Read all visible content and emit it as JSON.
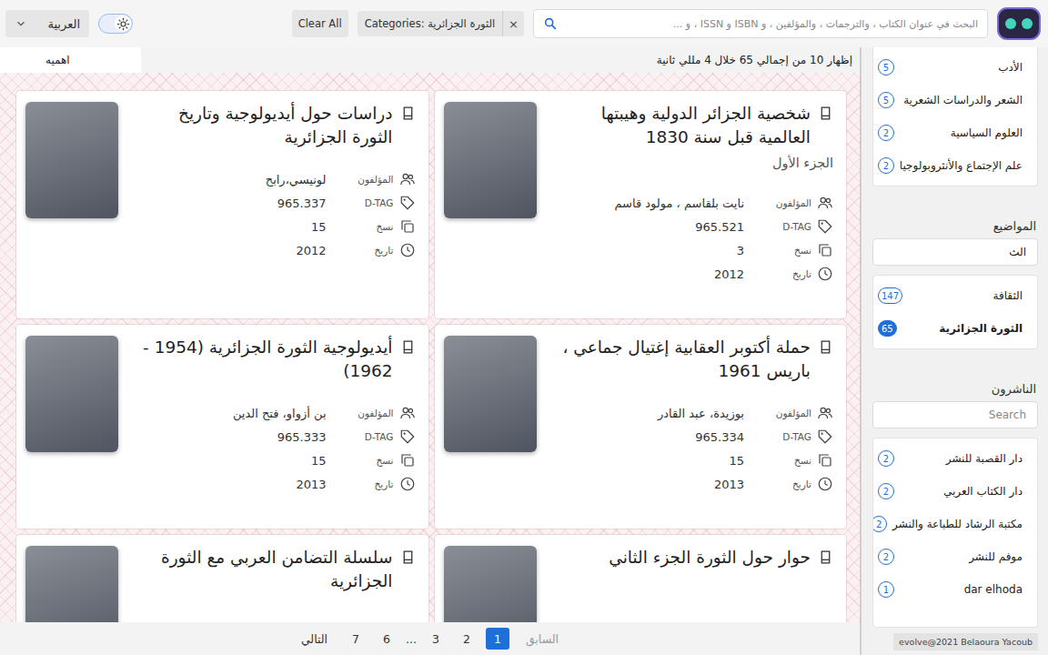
{
  "header": {
    "search": {
      "placeholder": "البحث في عنوان الكتاب ، والترجمات ، والمؤلفين ، و ISBN و ISSN ، و ..."
    },
    "filter_chip": {
      "label": "Categories: الثورة الجزائرية",
      "remove": "×"
    },
    "clear_all": "Clear All",
    "theme_toggle": {
      "dark": false
    },
    "language": "العربية"
  },
  "results": {
    "summary": "إظهار 10 من إجمالي 65 خلال 4 مللي ثانية",
    "sort": "اهميه"
  },
  "field_labels": {
    "authors": "المؤلفون",
    "tag": "D-TAG",
    "copies": "نسخ",
    "date": "تاريخ"
  },
  "books": [
    {
      "title": "شخصية الجزائر الدولية وهيبتها العالمية قبل سنة 1830",
      "subtitle": "الجزء الأول",
      "authors": "نايت بلقاسم ، مولود قاسم",
      "tag": "965.521",
      "copies": "3",
      "date": "2012"
    },
    {
      "title": "دراسات حول أيديولوجية وتاريخ الثورة الجزائرية",
      "authors": "لونيسي،رابح",
      "tag": "965.337",
      "copies": "15",
      "date": "2012"
    },
    {
      "title": "حملة أكتوبر العقابية إغتيال جماعي ، باريس 1961",
      "authors": "بوزيدة، عبد القادر",
      "tag": "965.334",
      "copies": "15",
      "date": "2013"
    },
    {
      "title": "أيديولوجية الثورة الجزائرية (1954 - 1962)",
      "authors": "بن أزواو، فتح الدين",
      "tag": "965.333",
      "copies": "15",
      "date": "2013"
    },
    {
      "title": "حوار حول الثورة الجزء الثاني"
    },
    {
      "title": "سلسلة التضامن العربي مع الثورة الجزائرية"
    }
  ],
  "pagination": {
    "prev": {
      "label": "السابق",
      "disabled": true
    },
    "next": {
      "label": "التالي",
      "disabled": false
    },
    "pages": [
      {
        "label": "1",
        "kind": "page",
        "selected": true
      },
      {
        "label": "2",
        "kind": "page",
        "selected": false
      },
      {
        "label": "3",
        "kind": "page",
        "selected": false
      },
      {
        "label": "...",
        "kind": "ellipsis",
        "selected": false
      },
      {
        "label": "6",
        "kind": "page",
        "selected": false
      },
      {
        "label": "7",
        "kind": "page",
        "selected": false
      }
    ]
  },
  "sidebar": {
    "categories": {
      "items": [
        {
          "label": "الأدب",
          "count": "5",
          "selected": false
        },
        {
          "label": "الشعر والدراسات الشعرية",
          "count": "5",
          "selected": false
        },
        {
          "label": "العلوم السياسية",
          "count": "2",
          "selected": false
        },
        {
          "label": "علم الإجتماع والأنثروبولوجيا",
          "count": "2",
          "selected": false
        }
      ]
    },
    "topics": {
      "title": "المواضيع",
      "query": "الث",
      "items": [
        {
          "label": "الثقافة",
          "count": "147",
          "selected": false
        },
        {
          "label": "الثورة الجزائرية",
          "count": "65",
          "selected": true
        }
      ]
    },
    "publishers": {
      "title": "الناشرون",
      "placeholder": "Search",
      "items": [
        {
          "label": "دار القصبة للنشر",
          "count": "2",
          "selected": false
        },
        {
          "label": "دار الكتاب العربي",
          "count": "2",
          "selected": false
        },
        {
          "label": "مكتبة الرشاد للطباعة والنشر",
          "count": "2",
          "selected": false
        },
        {
          "label": "موفم للنشر",
          "count": "2",
          "selected": false
        },
        {
          "label": "dar elhoda",
          "count": "1",
          "selected": false
        }
      ]
    }
  },
  "footer": "evolve@2021 Belaoura Yacoub"
}
